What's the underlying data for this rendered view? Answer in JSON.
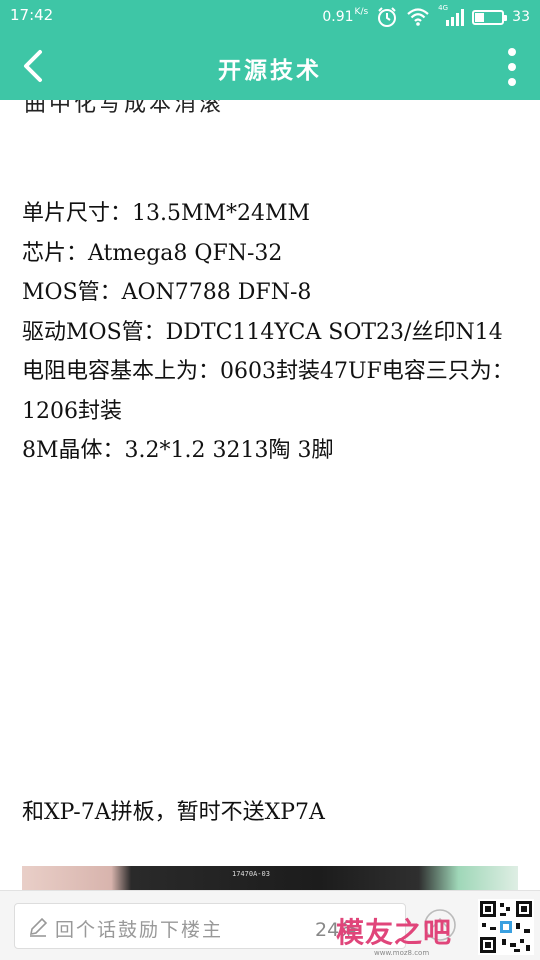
{
  "status_bar": {
    "time": "17:42",
    "speed": "0.91",
    "speed_unit": "K/s",
    "network": "4G",
    "battery": "33",
    "battery_level": 0.33
  },
  "header": {
    "title": "开源技术"
  },
  "content": {
    "cutoff_line": "曲中化写成本消滚",
    "specs": [
      "单片尺寸：13.5MM*24MM",
      "芯片：Atmega8 QFN-32",
      "MOS管：AON7788 DFN-8",
      "驱动MOS管：DDTC114YCA SOT23/丝印N14",
      "电阻电容基本上为：0603封装47UF电容三只为：1206封装",
      "8M晶体：3.2*1.2 3213陶 3脚"
    ],
    "caption": "和XP-7A拼板，暂时不送XP7A",
    "photo_label": "17470A-03"
  },
  "bottom_bar": {
    "comment_placeholder": "回个话鼓励下楼主",
    "comment_count": "24条",
    "watermark": "模友之吧",
    "watermark_url": "www.moz8.com"
  },
  "colors": {
    "accent": "#3ec6a6",
    "watermark": "#e0457a"
  },
  "icons": [
    "back-arrow-icon",
    "more-vertical-icon",
    "pencil-icon",
    "reply-icon",
    "alarm-icon",
    "wifi-icon",
    "signal-icon",
    "battery-icon",
    "qr-code"
  ]
}
